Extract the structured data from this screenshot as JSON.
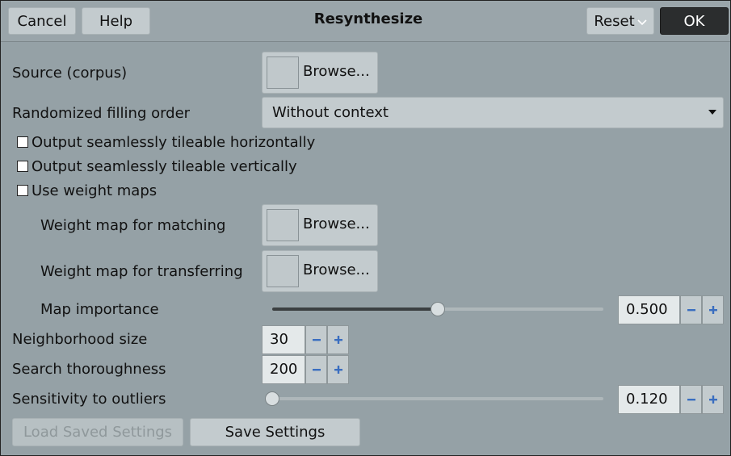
{
  "titlebar": {
    "title": "Resynthesize",
    "cancel_label": "Cancel",
    "help_label": "Help",
    "reset_label": "Reset",
    "ok_label": "OK"
  },
  "form": {
    "source_label": "Source (corpus)",
    "browse_label": "Browse...",
    "fill_order_label": "Randomized filling order",
    "fill_order_value": "Without context",
    "tile_h_label": "Output seamlessly tileable horizontally",
    "tile_h_checked": false,
    "tile_v_label": "Output seamlessly tileable vertically",
    "tile_v_checked": false,
    "weight_maps_label": "Use weight maps",
    "weight_maps_checked": false,
    "wm_matching_label": "Weight map for matching",
    "wm_transfer_label": "Weight map for transferring",
    "map_importance_label": "Map importance",
    "map_importance_value": "0.500",
    "map_importance_fraction": 0.5,
    "neighborhood_label": "Neighborhood size",
    "neighborhood_value": "30",
    "thoroughness_label": "Search thoroughness",
    "thoroughness_value": "200",
    "sensitivity_label": "Sensitivity to outliers",
    "sensitivity_value": "0.120",
    "sensitivity_fraction": 0.0
  },
  "footer": {
    "load_label": "Load Saved Settings",
    "save_label": "Save Settings"
  },
  "colors": {
    "background": "#95a1a6",
    "button": "#c3cbce",
    "ok_button": "#2b2d2e",
    "spin_icon": "#3a6ec0"
  }
}
